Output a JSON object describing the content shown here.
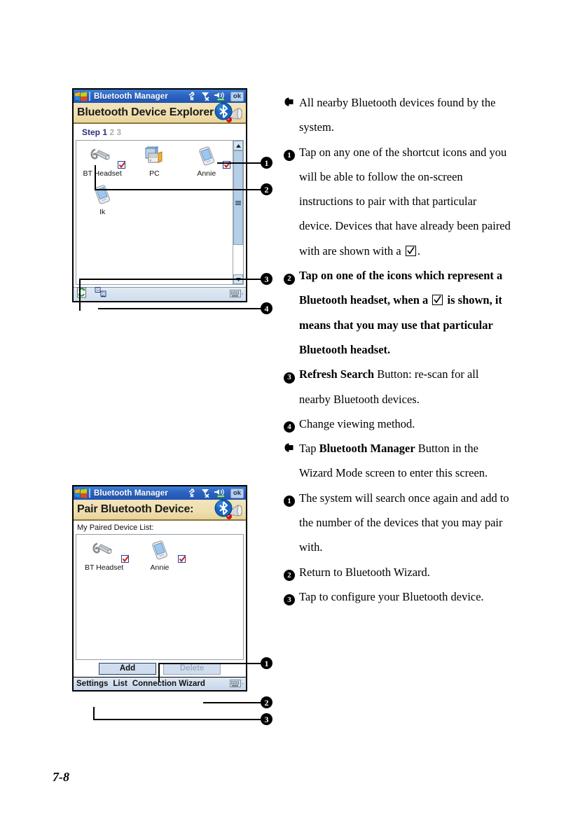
{
  "page": {
    "number": "7-8"
  },
  "screen1": {
    "titlebar": {
      "app_title": "Bluetooth Manager",
      "ok_label": "ok",
      "icons": [
        "connectivity-off-icon",
        "signal-off-icon",
        "volume-icon"
      ]
    },
    "banner": {
      "text": "Bluetooth Device Explorer",
      "logo": "bluetooth-speaker-logo"
    },
    "step": {
      "prefix": "Step",
      "active": "1",
      "inactive": [
        "2",
        "3"
      ]
    },
    "devices": [
      {
        "name": "BT Headset",
        "icon": "bt-headset-icon",
        "paired": true
      },
      {
        "name": "PC",
        "icon": "pc-icon",
        "paired": false
      },
      {
        "name": "Annie",
        "icon": "pda-icon",
        "paired": true
      },
      {
        "name": "Ik",
        "icon": "pda-icon",
        "paired": false
      }
    ],
    "toolbar": {
      "refresh": "refresh-search-icon",
      "view": "change-view-icon",
      "sip": "keyboard-input-icon"
    },
    "scrollbar": {
      "up": "scroll-up-arrow-icon",
      "down": "scroll-down-arrow-icon"
    }
  },
  "screen2": {
    "titlebar": {
      "app_title": "Bluetooth Manager",
      "ok_label": "ok"
    },
    "banner": {
      "text": "Pair Bluetooth Device:",
      "logo": "bluetooth-speaker-logo"
    },
    "list_label": "My Paired Device List:",
    "devices": [
      {
        "name": "BT Headset",
        "icon": "bt-headset-icon",
        "paired": true
      },
      {
        "name": "Annie",
        "icon": "pda-icon",
        "paired": true
      }
    ],
    "buttons": [
      {
        "label": "Add",
        "enabled": true
      },
      {
        "label": "Delete",
        "enabled": false
      }
    ],
    "taskbar": {
      "items": [
        "Settings",
        "List",
        "Connection Wizard"
      ],
      "sip": "keyboard-input-icon"
    }
  },
  "notes": [
    {
      "marker": "arrow",
      "bold": false,
      "segments": [
        {
          "t": "All nearby Bluetooth devices found by the system.",
          "b": false
        }
      ]
    },
    {
      "marker": "1",
      "bold": false,
      "segments": [
        {
          "t": "Tap on any one of the shortcut icons and you will be able to follow the on-screen instructions to pair with that particular device. Devices that have already been paired with are shown with a ",
          "b": false
        },
        {
          "t": "[check]",
          "b": false
        },
        {
          "t": ".",
          "b": false
        }
      ]
    },
    {
      "marker": "2",
      "bold": true,
      "segments": [
        {
          "t": "Tap on one of the icons which represent a Bluetooth headset, when a ",
          "b": true
        },
        {
          "t": "[check]",
          "b": true
        },
        {
          "t": " is shown, it means that you may use that particular Bluetooth headset.",
          "b": true
        }
      ]
    },
    {
      "marker": "3",
      "bold": false,
      "segments": [
        {
          "t": "Refresh Search",
          "b": true
        },
        {
          "t": " Button: re-scan for all nearby Bluetooth devices.",
          "b": false
        }
      ]
    },
    {
      "marker": "4",
      "bold": false,
      "segments": [
        {
          "t": "Change viewing method.",
          "b": false
        }
      ]
    },
    {
      "marker": "arrow",
      "bold": false,
      "segments": [
        {
          "t": "Tap ",
          "b": false
        },
        {
          "t": "Bluetooth Manager",
          "b": true
        },
        {
          "t": " Button in the Wizard Mode screen to enter this screen.",
          "b": false
        }
      ]
    },
    {
      "marker": "1",
      "bold": false,
      "segments": [
        {
          "t": "The system will search once again and add to the number of the devices that you may pair with.",
          "b": false
        }
      ]
    },
    {
      "marker": "2",
      "bold": false,
      "segments": [
        {
          "t": "Return to Bluetooth Wizard.",
          "b": false
        }
      ]
    },
    {
      "marker": "3",
      "bold": false,
      "segments": [
        {
          "t": "Tap to configure your Bluetooth device.",
          "b": false
        }
      ]
    }
  ],
  "callouts": {
    "screen1": [
      "1",
      "2",
      "3",
      "4"
    ],
    "screen2": [
      "1",
      "2",
      "3"
    ]
  },
  "colors": {
    "titlebar_blue": "#2255b4",
    "banner_tan": "#efdfae",
    "step_active": "#2b2f7a",
    "step_inactive": "#adadad",
    "bluetooth_blue": "#1565c0",
    "check_red": "#cc2222",
    "refresh_green": "#1a9e3e"
  }
}
